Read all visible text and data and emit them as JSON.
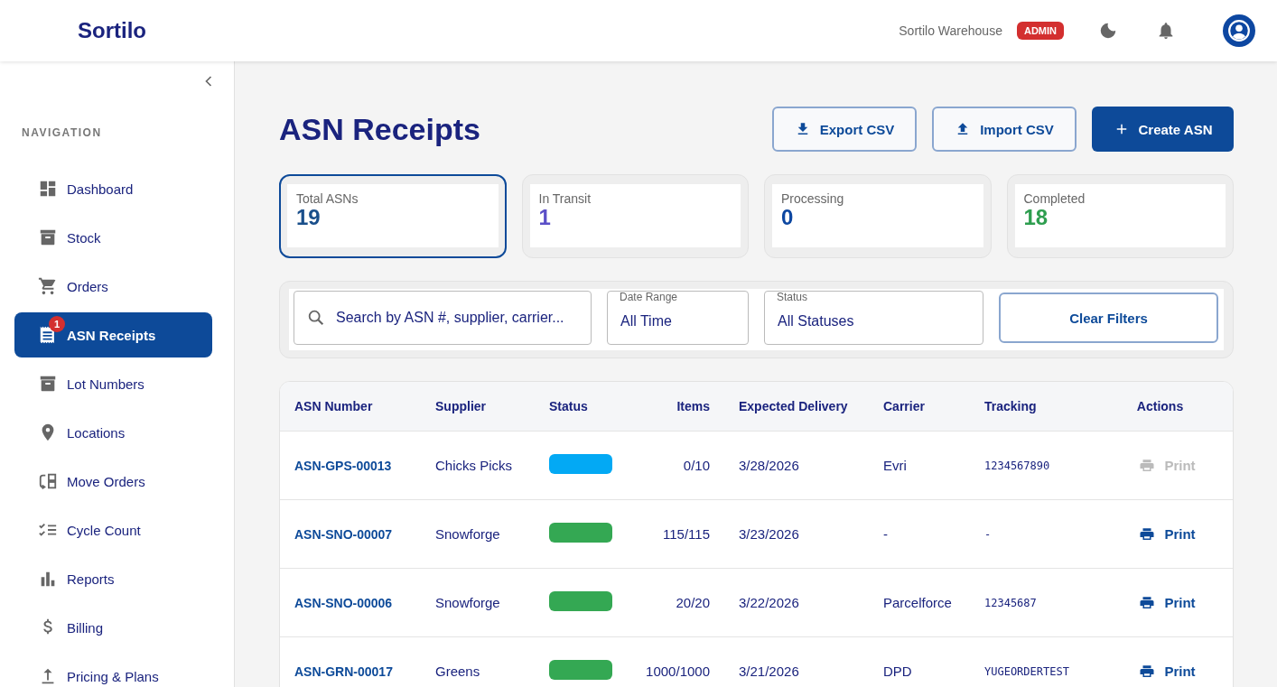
{
  "header": {
    "logo": "Sortilo",
    "warehouse": "Sortilo Warehouse",
    "role_badge": "ADMIN"
  },
  "sidebar": {
    "section_label": "NAVIGATION",
    "items": [
      {
        "label": "Dashboard",
        "selected": false
      },
      {
        "label": "Stock",
        "selected": false
      },
      {
        "label": "Orders",
        "selected": false
      },
      {
        "label": "ASN Receipts",
        "selected": true,
        "badge": "1"
      },
      {
        "label": "Lot Numbers",
        "selected": false
      },
      {
        "label": "Locations",
        "selected": false
      },
      {
        "label": "Move Orders",
        "selected": false
      },
      {
        "label": "Cycle Count",
        "selected": false
      },
      {
        "label": "Reports",
        "selected": false
      },
      {
        "label": "Billing",
        "selected": false
      },
      {
        "label": "Pricing & Plans",
        "selected": false
      }
    ]
  },
  "page": {
    "title": "ASN Receipts",
    "buttons": [
      {
        "label": "Export CSV",
        "kind": "export"
      },
      {
        "label": "Import CSV",
        "kind": "import"
      },
      {
        "label": "Create ASN",
        "kind": "create"
      }
    ]
  },
  "stats": [
    {
      "label": "Total ASNs",
      "value": "19",
      "color": "#1a4f8b",
      "selected": true
    },
    {
      "label": "In Transit",
      "value": "1",
      "color": "#5b4fc7",
      "selected": false
    },
    {
      "label": "Processing",
      "value": "0",
      "color": "#0d47a1",
      "selected": false
    },
    {
      "label": "Completed",
      "value": "18",
      "color": "#2e9e4f",
      "selected": false
    }
  ],
  "filters": {
    "search": {
      "placeholder": "Search by ASN #, supplier, carrier..."
    },
    "date_range": {
      "label": "Date Range",
      "value": "All Time"
    },
    "status": {
      "label": "Status",
      "value": "All Statuses"
    },
    "clear_button": "Clear Filters"
  },
  "table": {
    "columns": [
      "ASN Number",
      "Supplier",
      "Status",
      "Items",
      "Expected Delivery",
      "Carrier",
      "Tracking",
      "Actions"
    ],
    "rows": [
      {
        "asn": "ASN-GPS-00013",
        "supplier": "Chicks Picks",
        "color": "#03a9f4",
        "items": "0/10",
        "expected": "3/28/2026",
        "carrier": "Evri",
        "tracking": "1234567890",
        "action": "Print",
        "action_disabled": true
      },
      {
        "asn": "ASN-SNO-00007",
        "supplier": "Snowforge",
        "color": "#34a853",
        "items": "115/115",
        "expected": "3/23/2026",
        "carrier": "-",
        "tracking": "-",
        "action": "Print",
        "action_disabled": false
      },
      {
        "asn": "ASN-SNO-00006",
        "supplier": "Snowforge",
        "color": "#34a853",
        "items": "20/20",
        "expected": "3/22/2026",
        "carrier": "Parcelforce",
        "tracking": "12345687",
        "action": "Print",
        "action_disabled": false
      },
      {
        "asn": "ASN-GRN-00017",
        "supplier": "Greens",
        "color": "#34a853",
        "items": "1000/1000",
        "expected": "3/21/2026",
        "carrier": "DPD",
        "tracking": "YUGEORDERTEST",
        "action": "Print",
        "action_disabled": false
      }
    ]
  }
}
